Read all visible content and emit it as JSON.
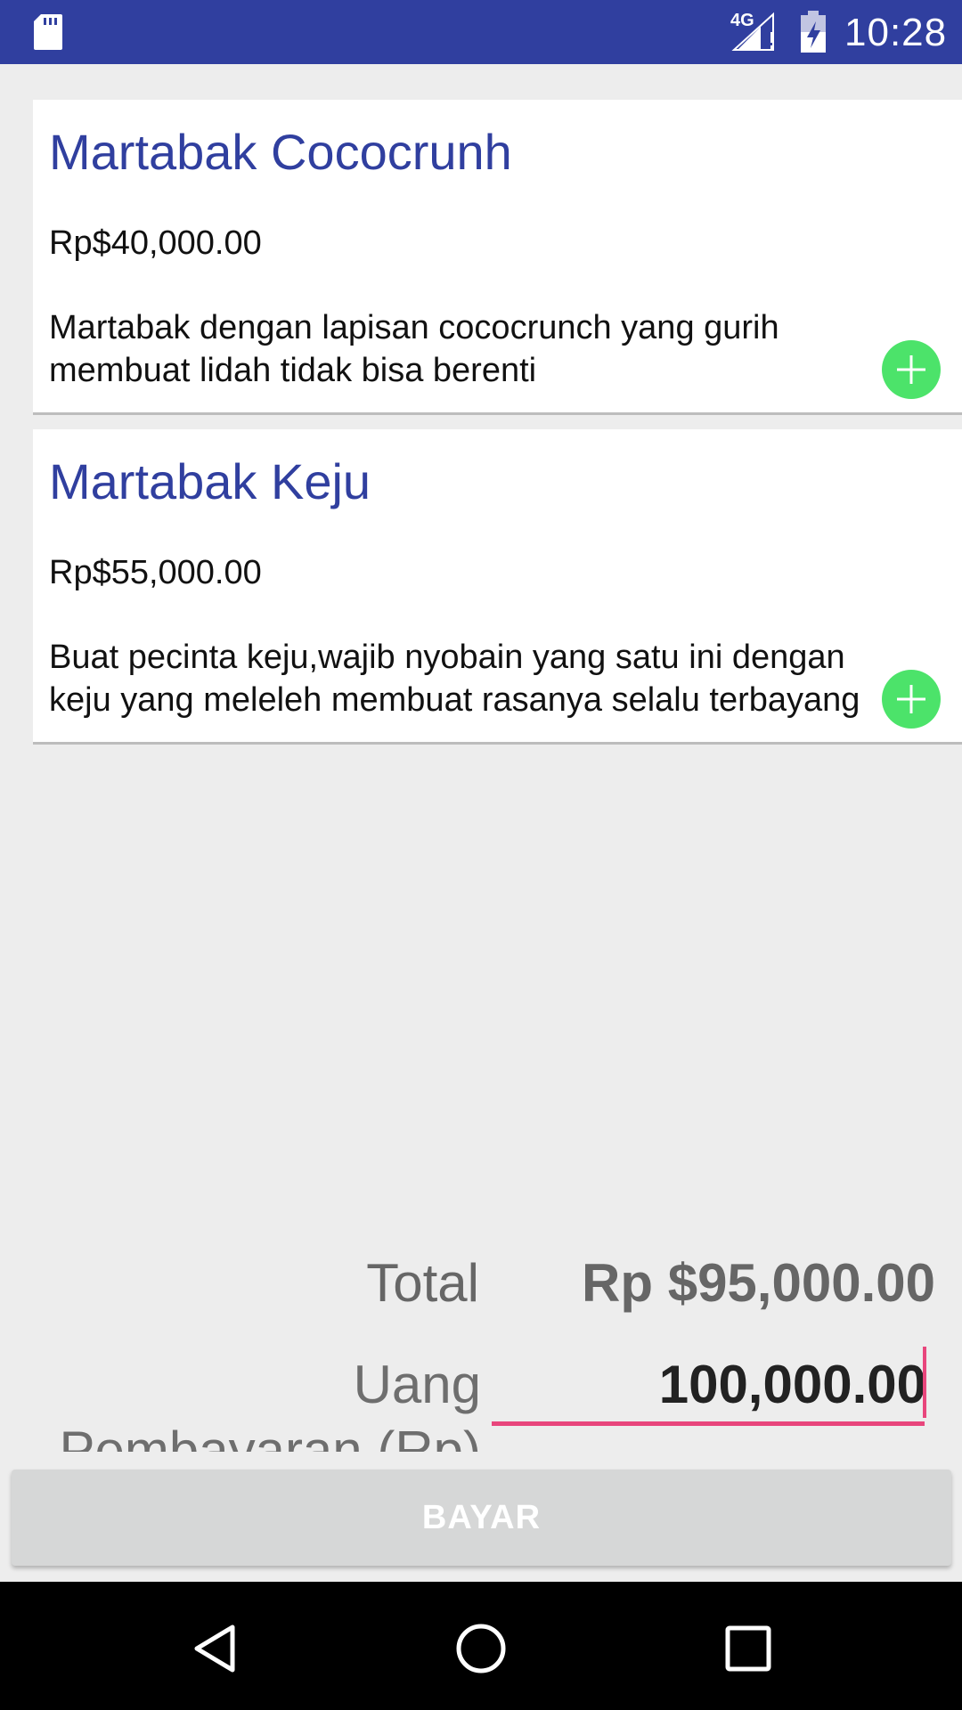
{
  "status_bar": {
    "network_label": "4G",
    "time": "10:28",
    "icons": [
      "sd-card-icon",
      "signal-icon",
      "battery-charging-icon"
    ]
  },
  "menu_items": [
    {
      "title": "Martabak Cococrunh",
      "price": "Rp$40,000.00",
      "description_lines": [
        "Martabak dengan lapisan cococrunch yang gurih",
        "membuat lidah tidak bisa berenti"
      ]
    },
    {
      "title": "Martabak Keju",
      "price": "Rp$55,000.00",
      "description_lines": [
        "Buat pecinta keju,wajib nyobain yang satu ini dengan",
        "keju yang meleleh membuat rasanya selalu terbayang"
      ]
    }
  ],
  "summary": {
    "total_label": "Total",
    "total_value": "Rp $95,000.00",
    "payment_label": "Uang Pembayaran (Rp)",
    "payment_value": "100,000.00"
  },
  "actions": {
    "pay_label": "BAYAR"
  },
  "colors": {
    "primary": "#303f9f",
    "accent": "#e8467c",
    "add_button": "#4ce36a",
    "background": "#ededed"
  }
}
